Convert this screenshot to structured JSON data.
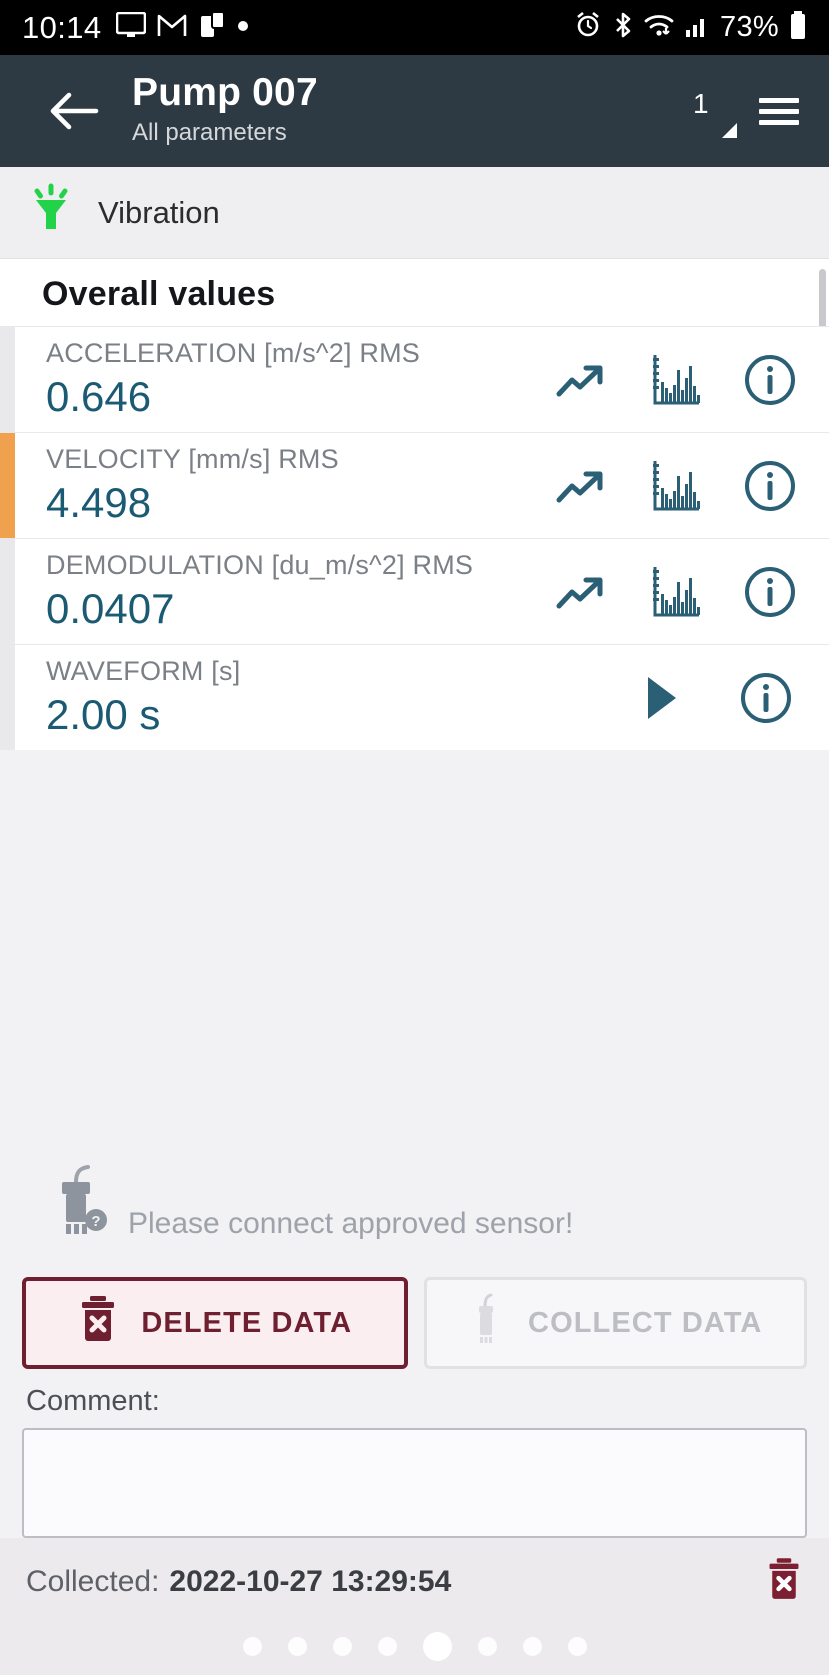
{
  "statusbar": {
    "time": "10:14",
    "battery": "73%",
    "left_icons": [
      "monitor-icon",
      "gmail-icon",
      "app-icon",
      "dot-icon"
    ],
    "right_icons": [
      "alarm-icon",
      "bluetooth-icon",
      "wifi-icon",
      "signal-icon",
      "battery-icon"
    ]
  },
  "appbar": {
    "back_icon": "back-arrow-icon",
    "title": "Pump 007",
    "subtitle": "All parameters",
    "count": "1",
    "menu_icon": "list-menu-icon"
  },
  "sensor_bar": {
    "icon": "vibration-sensor-icon",
    "icon_color": "#22d34a",
    "label": "Vibration"
  },
  "overall": {
    "heading": "Overall values",
    "rows": [
      {
        "label": "ACCELERATION [m/s^2] RMS",
        "value": "0.646",
        "status": "normal",
        "icons": [
          "trend-up-icon",
          "spectrum-chart-icon",
          "info-icon"
        ]
      },
      {
        "label": "VELOCITY [mm/s] RMS",
        "value": "4.498",
        "status": "warning",
        "status_color": "#efa14d",
        "icons": [
          "trend-up-icon",
          "spectrum-chart-icon",
          "info-icon"
        ]
      },
      {
        "label": "DEMODULATION [du_m/s^2] RMS",
        "value": "0.0407",
        "status": "normal",
        "icons": [
          "trend-up-icon",
          "spectrum-chart-icon",
          "info-icon"
        ]
      },
      {
        "label": "WAVEFORM [s]",
        "value": "2.00 s",
        "status": "normal",
        "icons": [
          "play-icon",
          "info-icon"
        ]
      }
    ]
  },
  "notice": {
    "icon": "sensor-help-icon",
    "text": "Please connect approved sensor!"
  },
  "actions": {
    "delete_label": "DELETE DATA",
    "delete_icon": "trash-x-icon",
    "delete_color": "#6e2030",
    "collect_label": "COLLECT DATA",
    "collect_icon": "sensor-icon",
    "collect_disabled": true
  },
  "comment": {
    "label": "Comment:",
    "value": "",
    "placeholder": ""
  },
  "footer": {
    "collected_label": "Collected:",
    "collected_value": "2022-10-27 13:29:54",
    "trash_icon": "trash-x-icon"
  },
  "pagination": {
    "total": 8,
    "active_index": 4
  },
  "colors": {
    "appbar": "#2e3a43",
    "value_text": "#1b5a73",
    "warning": "#efa14d",
    "danger": "#6e2030",
    "sensor_green": "#22d34a"
  }
}
